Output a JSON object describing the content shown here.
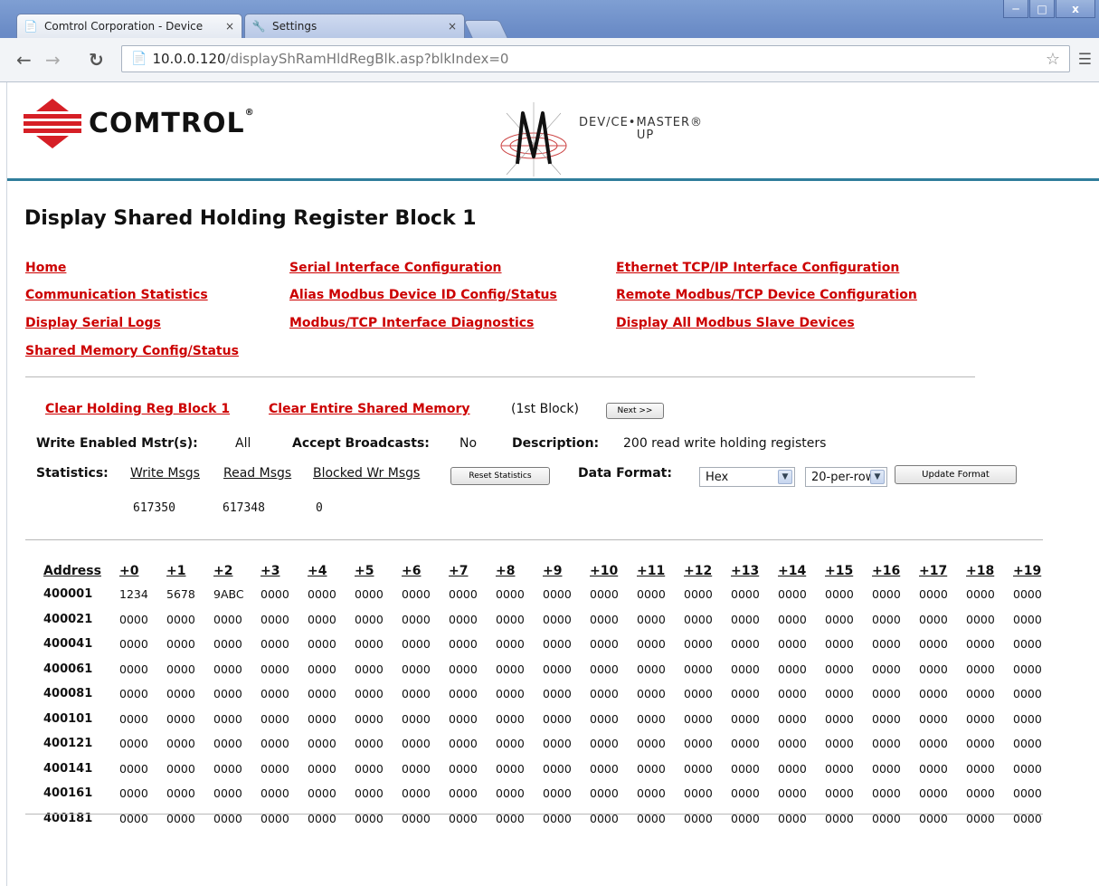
{
  "browser": {
    "tabs": [
      {
        "title": "Comtrol Corporation - Device",
        "close": "×"
      },
      {
        "title": "Settings",
        "close": "×"
      }
    ],
    "url_host": "10.0.0.120",
    "url_path": "/displayShRamHldRegBlk.asp?blkIndex=0",
    "window_buttons": {
      "minimize": "─",
      "maximize": "□",
      "close": "x"
    }
  },
  "header": {
    "comtrol_logo_text": "COMTROL",
    "comtrol_reg": "®",
    "devicemaster_text": "DEV/CE•MASTER®",
    "devicemaster_sub": "UP"
  },
  "page_title": "Display Shared Holding Register Block 1",
  "nav": [
    "Home",
    "Serial Interface Configuration",
    "Ethernet TCP/IP Interface Configuration",
    "Communication Statistics",
    "Alias Modbus Device ID Config/Status",
    "Remote Modbus/TCP Device Configuration",
    "Display Serial Logs",
    "Modbus/TCP Interface Diagnostics",
    "Display All Modbus Slave Devices",
    "Shared Memory Config/Status"
  ],
  "actions": {
    "clear_block": "Clear Holding Reg Block 1",
    "clear_all": "Clear Entire Shared Memory",
    "block_note": "(1st Block)",
    "next_button": "Next >>"
  },
  "info": {
    "write_enabled_label": "Write Enabled Mstr(s):",
    "write_enabled_value": "All",
    "accept_broadcasts_label": "Accept Broadcasts:",
    "accept_broadcasts_value": "No",
    "description_label": "Description:",
    "description_value": "200 read write holding registers"
  },
  "statistics": {
    "label": "Statistics:",
    "write_msgs_label": "Write Msgs",
    "read_msgs_label": "Read Msgs",
    "blocked_label": "Blocked Wr Msgs",
    "reset_button": "Reset Statistics",
    "write_msgs": "617350",
    "read_msgs": "617348",
    "blocked": "0"
  },
  "format": {
    "label": "Data Format:",
    "format_value": "Hex",
    "per_row_value": "20-per-row",
    "update_button": "Update Format"
  },
  "table": {
    "headers": [
      "Address",
      "+0",
      "+1",
      "+2",
      "+3",
      "+4",
      "+5",
      "+6",
      "+7",
      "+8",
      "+9",
      "+10",
      "+11",
      "+12",
      "+13",
      "+14",
      "+15",
      "+16",
      "+17",
      "+18",
      "+19"
    ],
    "rows": [
      [
        "400001",
        "1234",
        "5678",
        "9ABC",
        "0000",
        "0000",
        "0000",
        "0000",
        "0000",
        "0000",
        "0000",
        "0000",
        "0000",
        "0000",
        "0000",
        "0000",
        "0000",
        "0000",
        "0000",
        "0000",
        "0000"
      ],
      [
        "400021",
        "0000",
        "0000",
        "0000",
        "0000",
        "0000",
        "0000",
        "0000",
        "0000",
        "0000",
        "0000",
        "0000",
        "0000",
        "0000",
        "0000",
        "0000",
        "0000",
        "0000",
        "0000",
        "0000",
        "0000"
      ],
      [
        "400041",
        "0000",
        "0000",
        "0000",
        "0000",
        "0000",
        "0000",
        "0000",
        "0000",
        "0000",
        "0000",
        "0000",
        "0000",
        "0000",
        "0000",
        "0000",
        "0000",
        "0000",
        "0000",
        "0000",
        "0000"
      ],
      [
        "400061",
        "0000",
        "0000",
        "0000",
        "0000",
        "0000",
        "0000",
        "0000",
        "0000",
        "0000",
        "0000",
        "0000",
        "0000",
        "0000",
        "0000",
        "0000",
        "0000",
        "0000",
        "0000",
        "0000",
        "0000"
      ],
      [
        "400081",
        "0000",
        "0000",
        "0000",
        "0000",
        "0000",
        "0000",
        "0000",
        "0000",
        "0000",
        "0000",
        "0000",
        "0000",
        "0000",
        "0000",
        "0000",
        "0000",
        "0000",
        "0000",
        "0000",
        "0000"
      ],
      [
        "400101",
        "0000",
        "0000",
        "0000",
        "0000",
        "0000",
        "0000",
        "0000",
        "0000",
        "0000",
        "0000",
        "0000",
        "0000",
        "0000",
        "0000",
        "0000",
        "0000",
        "0000",
        "0000",
        "0000",
        "0000"
      ],
      [
        "400121",
        "0000",
        "0000",
        "0000",
        "0000",
        "0000",
        "0000",
        "0000",
        "0000",
        "0000",
        "0000",
        "0000",
        "0000",
        "0000",
        "0000",
        "0000",
        "0000",
        "0000",
        "0000",
        "0000",
        "0000"
      ],
      [
        "400141",
        "0000",
        "0000",
        "0000",
        "0000",
        "0000",
        "0000",
        "0000",
        "0000",
        "0000",
        "0000",
        "0000",
        "0000",
        "0000",
        "0000",
        "0000",
        "0000",
        "0000",
        "0000",
        "0000",
        "0000"
      ],
      [
        "400161",
        "0000",
        "0000",
        "0000",
        "0000",
        "0000",
        "0000",
        "0000",
        "0000",
        "0000",
        "0000",
        "0000",
        "0000",
        "0000",
        "0000",
        "0000",
        "0000",
        "0000",
        "0000",
        "0000",
        "0000"
      ],
      [
        "400181",
        "0000",
        "0000",
        "0000",
        "0000",
        "0000",
        "0000",
        "0000",
        "0000",
        "0000",
        "0000",
        "0000",
        "0000",
        "0000",
        "0000",
        "0000",
        "0000",
        "0000",
        "0000",
        "0000",
        "0000"
      ]
    ]
  },
  "colors": {
    "link_red": "#cc0000",
    "header_rule": "#2f7d9b",
    "chrome_blue": "#6a8bc6"
  }
}
